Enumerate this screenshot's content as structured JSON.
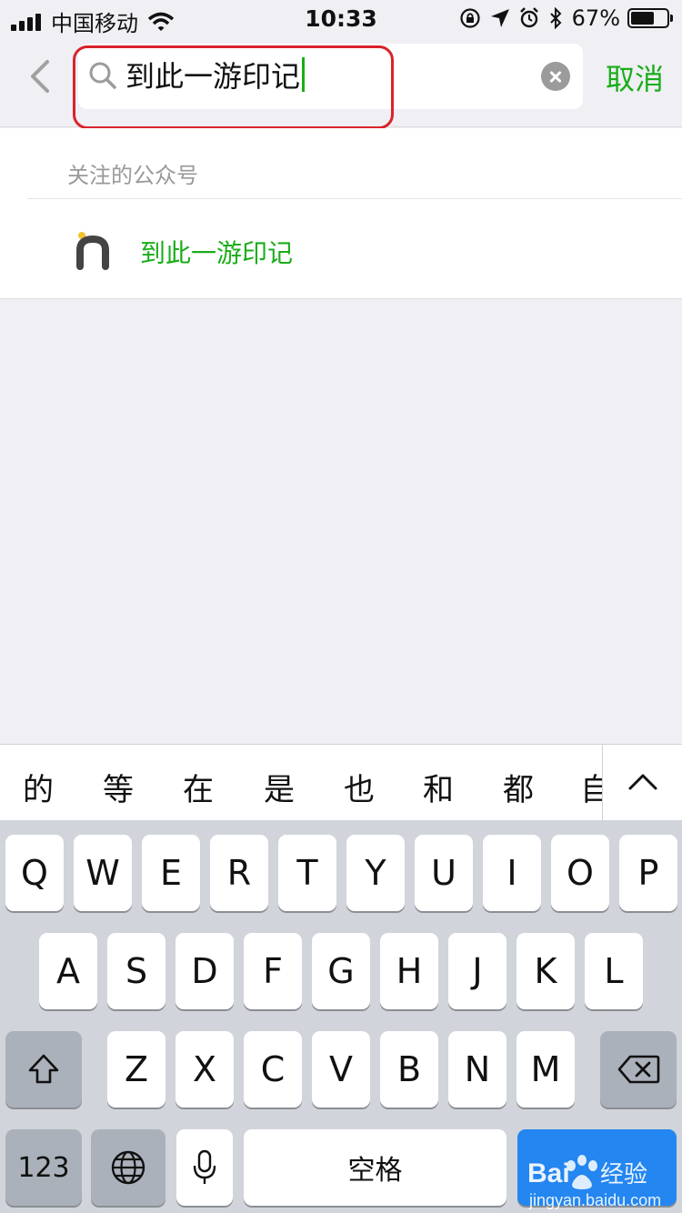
{
  "status_bar": {
    "carrier": "中国移动",
    "time": "10:33",
    "battery_percent_text": "67%",
    "battery_level": 0.67,
    "icons": [
      "signal-icon",
      "wifi-icon",
      "orientation-lock-icon",
      "location-icon",
      "alarm-icon",
      "bluetooth-icon",
      "battery-icon"
    ]
  },
  "search": {
    "query": "到此一游印记",
    "cancel_label": "取消"
  },
  "results": {
    "section_title": "关注的公众号",
    "items": [
      {
        "name": "到此一游印记"
      }
    ]
  },
  "candidates": [
    "的",
    "等",
    "在",
    "是",
    "也",
    "和",
    "都",
    "自"
  ],
  "keyboard": {
    "row1": [
      "Q",
      "W",
      "E",
      "R",
      "T",
      "Y",
      "U",
      "I",
      "O",
      "P"
    ],
    "row2": [
      "A",
      "S",
      "D",
      "F",
      "G",
      "H",
      "J",
      "K",
      "L"
    ],
    "row3": [
      "Z",
      "X",
      "C",
      "V",
      "B",
      "N",
      "M"
    ],
    "numbers_label": "123",
    "space_label": "空格"
  },
  "colors": {
    "accent_green": "#1aad19",
    "highlight_red": "#d9232a",
    "search_key_blue": "#2486f0"
  }
}
